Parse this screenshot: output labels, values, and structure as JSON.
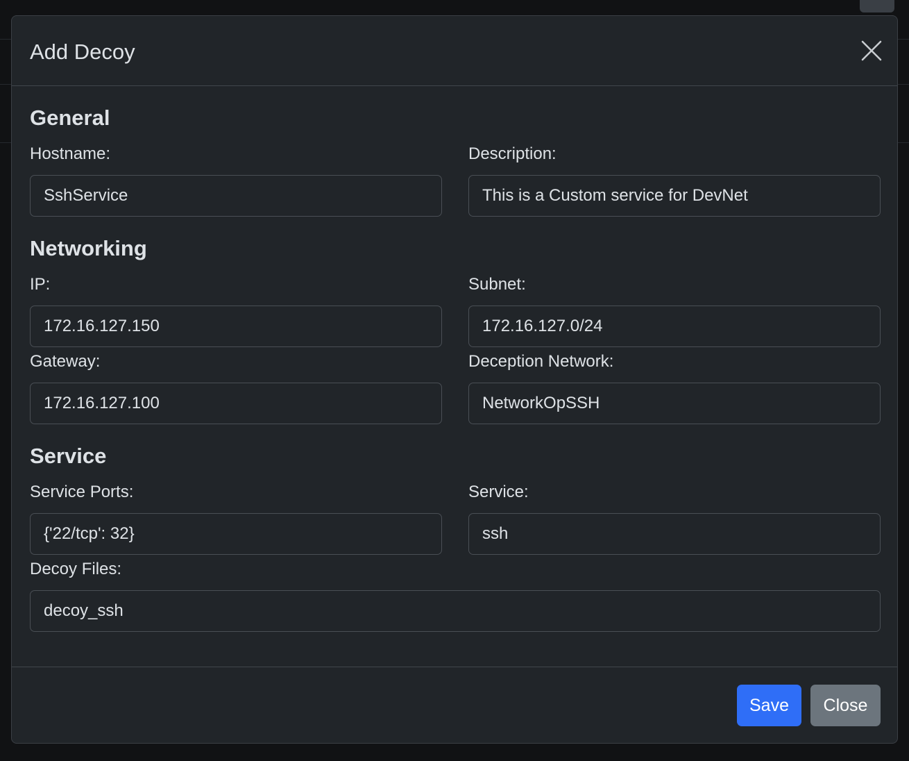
{
  "modal": {
    "title": "Add Decoy",
    "close_icon": "close-icon"
  },
  "sections": {
    "general": "General",
    "networking": "Networking",
    "service": "Service"
  },
  "fields": {
    "hostname": {
      "label": "Hostname:",
      "value": "SshService"
    },
    "description": {
      "label": "Description:",
      "value": "This is a Custom service for DevNet"
    },
    "ip": {
      "label": "IP:",
      "value": "172.16.127.150"
    },
    "subnet": {
      "label": "Subnet:",
      "value": "172.16.127.0/24"
    },
    "gateway": {
      "label": "Gateway:",
      "value": "172.16.127.100"
    },
    "deception_network": {
      "label": "Deception Network:",
      "value": "NetworkOpSSH"
    },
    "service_ports": {
      "label": "Service Ports:",
      "value": "{'22/tcp': 32}"
    },
    "service": {
      "label": "Service:",
      "value": "ssh"
    },
    "decoy_files": {
      "label": "Decoy Files:",
      "value": "decoy_ssh"
    }
  },
  "footer": {
    "save_label": "Save",
    "close_label": "Close"
  },
  "colors": {
    "modal_bg": "#212529",
    "primary": "#2f6ef7",
    "secondary": "#6c757d",
    "text": "#dee2e6"
  }
}
